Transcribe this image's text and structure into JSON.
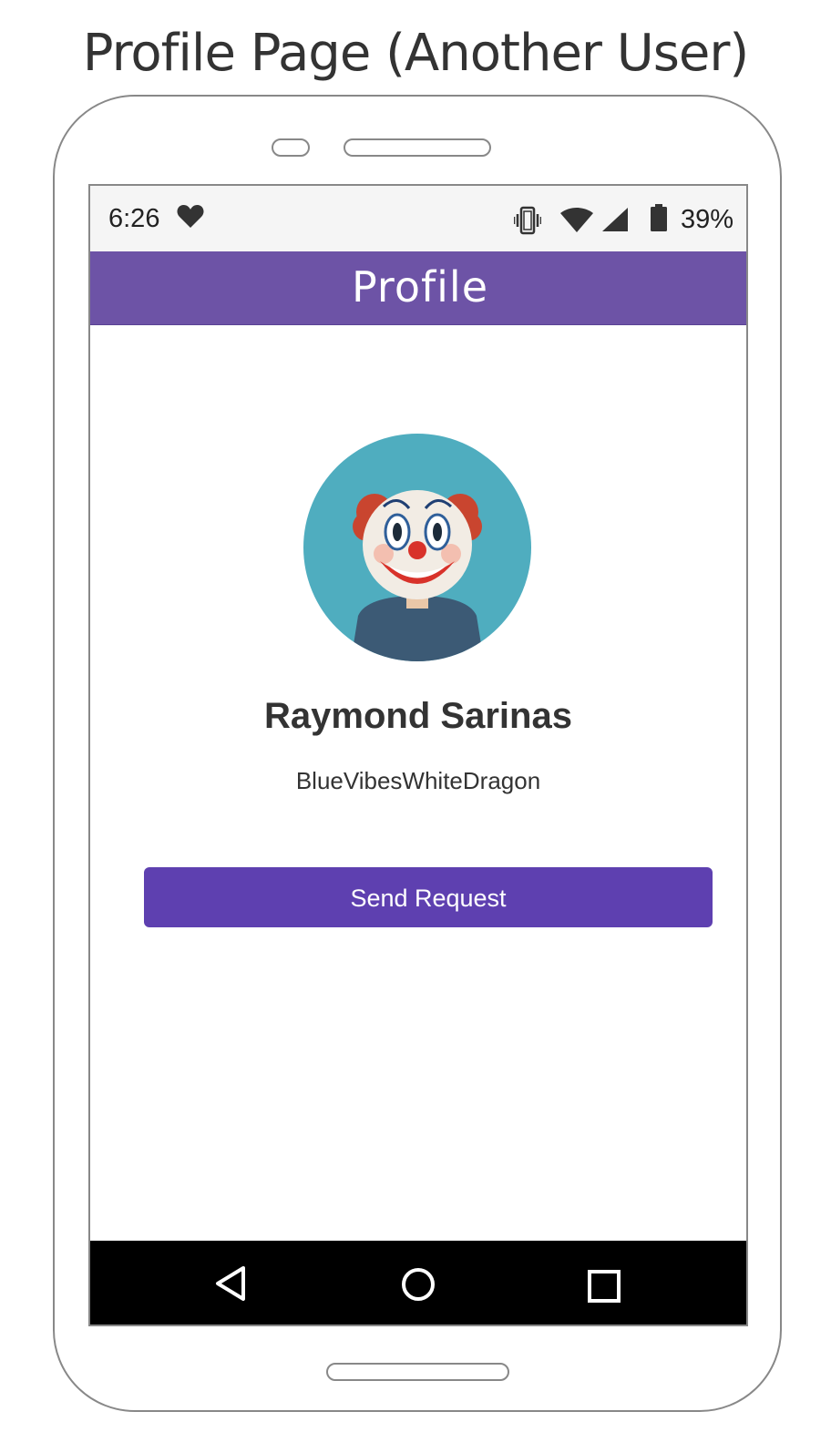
{
  "page_heading": "Profile Page (Another User)",
  "status_bar": {
    "time": "6:26",
    "battery_percent": "39%",
    "icons": [
      "heart-icon",
      "vibrate-icon",
      "wifi-icon",
      "signal-icon",
      "battery-icon"
    ]
  },
  "app_bar": {
    "title": "Profile"
  },
  "profile": {
    "avatar": "clown-avatar",
    "name": "Raymond Sarinas",
    "username": "BlueVibesWhiteDragon"
  },
  "actions": {
    "send_request_label": "Send Request"
  },
  "nav_bar": {
    "icons": [
      "back-icon",
      "home-icon",
      "recents-icon"
    ]
  },
  "colors": {
    "app_bar": "#6d53a6",
    "button": "#5e40b0",
    "avatar_bg": "#4fadbf",
    "nav_bar": "#000000"
  }
}
